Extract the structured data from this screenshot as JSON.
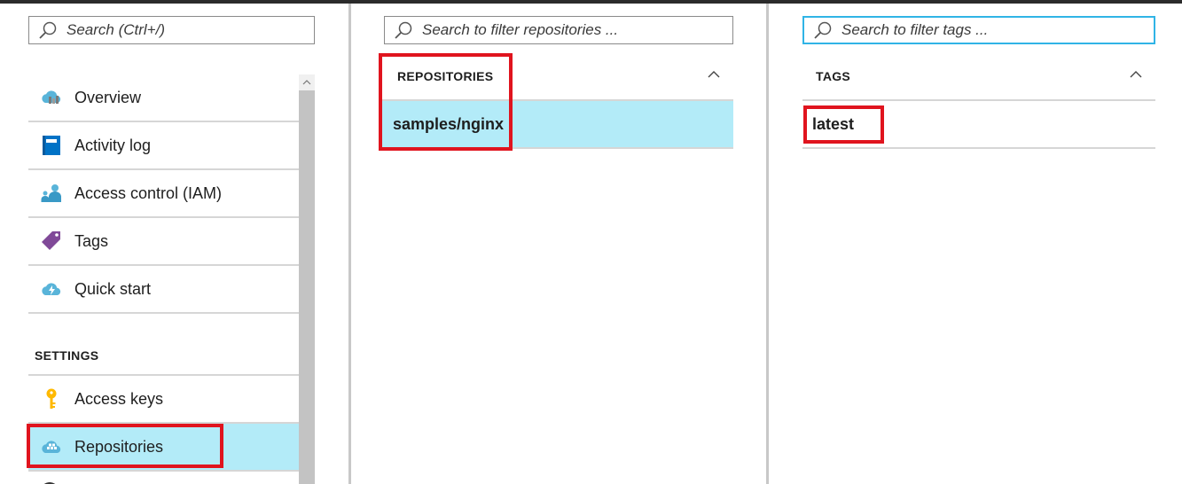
{
  "left_panel": {
    "search": {
      "placeholder": "Search (Ctrl+/)"
    },
    "menu_items": [
      {
        "label": "Overview",
        "icon": "overview-icon"
      },
      {
        "label": "Activity log",
        "icon": "activity-log-icon"
      },
      {
        "label": "Access control (IAM)",
        "icon": "access-control-icon"
      },
      {
        "label": "Tags",
        "icon": "tag-icon"
      },
      {
        "label": "Quick start",
        "icon": "quick-start-icon"
      }
    ],
    "settings_heading": "SETTINGS",
    "settings_items": [
      {
        "label": "Access keys",
        "icon": "key-icon"
      },
      {
        "label": "Repositories",
        "icon": "repositories-icon",
        "selected": true
      }
    ]
  },
  "middle_panel": {
    "search": {
      "placeholder": "Search to filter repositories ..."
    },
    "column_header": "REPOSITORIES",
    "rows": [
      {
        "name": "samples/nginx",
        "selected": true
      }
    ]
  },
  "right_panel": {
    "search": {
      "placeholder": "Search to filter tags ..."
    },
    "column_header": "TAGS",
    "rows": [
      {
        "name": "latest"
      }
    ]
  },
  "colors": {
    "selection": "#b3ebf8",
    "highlight": "#e0141e",
    "focus_border": "#30b4e6",
    "divider": "#d6d6d6"
  }
}
